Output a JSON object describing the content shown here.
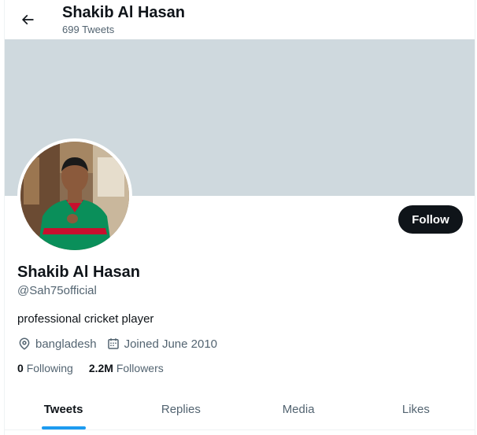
{
  "header": {
    "name": "Shakib Al Hasan",
    "tweet_count": "699 Tweets",
    "back_icon": "arrow-left-icon"
  },
  "banner": {
    "color": "#cfd9de"
  },
  "avatar": {
    "description_icon": "profile-photo"
  },
  "profile": {
    "name": "Shakib Al Hasan",
    "handle": "@Sah75official",
    "bio": "professional cricket player",
    "location": "bangladesh",
    "joined": "Joined June 2010",
    "location_icon": "location-pin-icon",
    "calendar_icon": "calendar-icon"
  },
  "actions": {
    "follow_label": "Follow"
  },
  "stats": {
    "following_count": "0",
    "following_label": "Following",
    "followers_count": "2.2M",
    "followers_label": "Followers"
  },
  "tabs": [
    {
      "label": "Tweets",
      "active": true
    },
    {
      "label": "Replies",
      "active": false
    },
    {
      "label": "Media",
      "active": false
    },
    {
      "label": "Likes",
      "active": false
    }
  ],
  "colors": {
    "accent": "#1d9bf0",
    "text_primary": "#0f1419",
    "text_secondary": "#536471",
    "follow_bg": "#0f1419"
  }
}
